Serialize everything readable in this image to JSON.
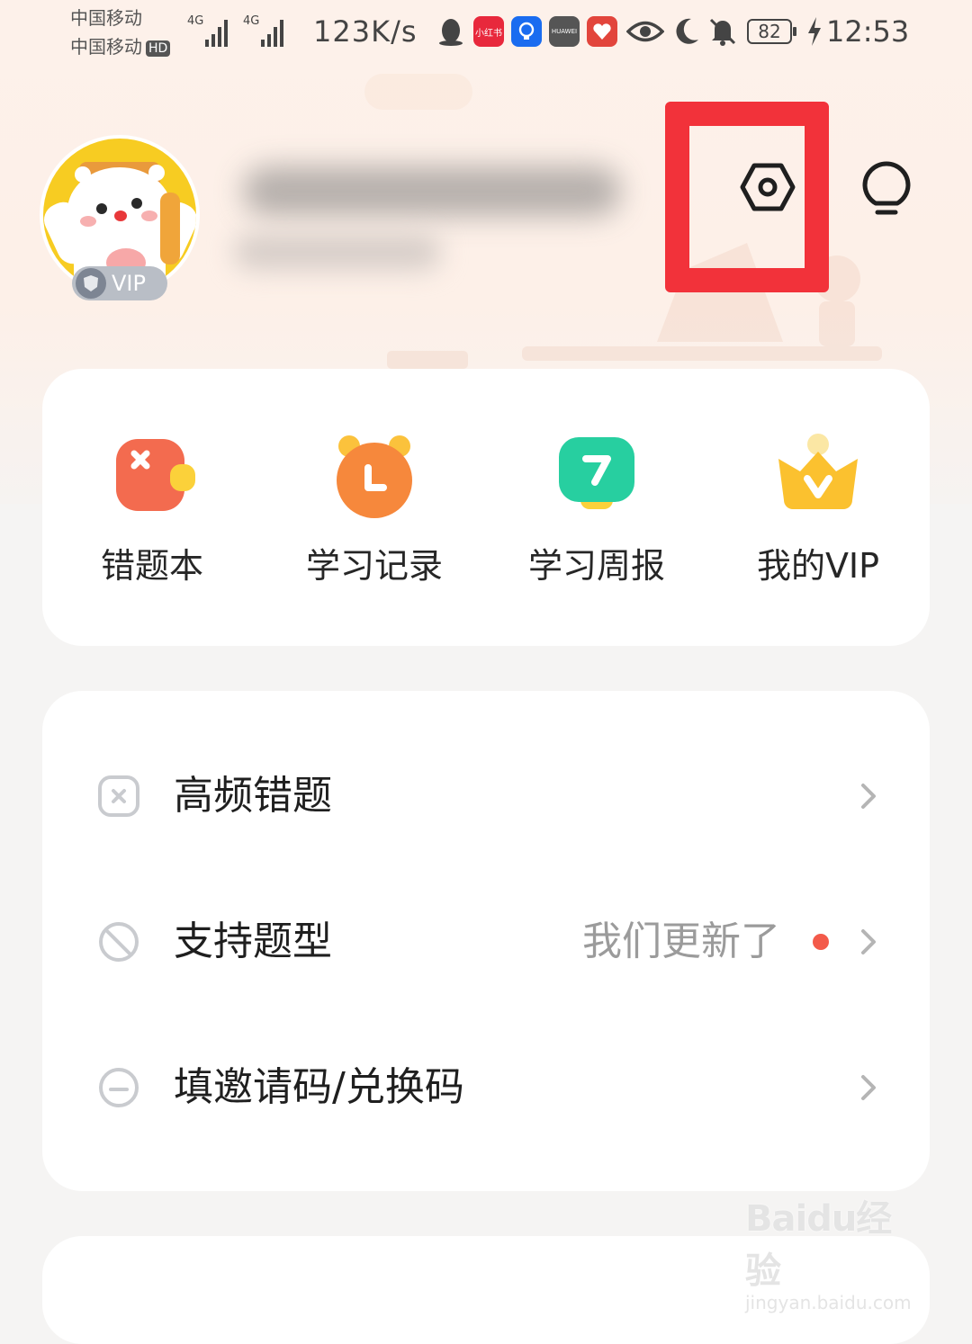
{
  "status_bar": {
    "carrier_1": "中国移动",
    "carrier_2": "中国移动",
    "hd_label": "HD",
    "network_tag_1": "4G",
    "network_tag_2": "4G",
    "speed": "123K/s",
    "app_icons": [
      "qq-icon",
      "xiaohongshu-icon",
      "lightbulb-app-icon",
      "huawei-store-icon",
      "pinduoduo-icon"
    ],
    "xiaohongshu_label": "小红书",
    "huawei_label": "HUAWEI",
    "battery": "82",
    "time": "12:53"
  },
  "profile": {
    "vip_badge": "VIP",
    "avatar_bg_color": "#f7cc22"
  },
  "header_actions": {
    "settings_icon": "settings-hexagon-icon",
    "message_icon": "message-bubble-icon",
    "highlight_color": "#f2323a"
  },
  "quick_actions": [
    {
      "label": "错题本",
      "icon": "wrong-questions-book-icon"
    },
    {
      "label": "学习记录",
      "icon": "study-record-clock-icon"
    },
    {
      "label": "学习周报",
      "icon": "weekly-report-calendar-icon"
    },
    {
      "label": "我的VIP",
      "icon": "vip-crown-icon"
    }
  ],
  "menu": [
    {
      "label": "高频错题",
      "icon": "close-square-icon",
      "note": ""
    },
    {
      "label": "支持题型",
      "icon": "shapes-icon",
      "note": "我们更新了",
      "has_dot": true
    },
    {
      "label": "填邀请码/兑换码",
      "icon": "coupon-icon",
      "note": ""
    }
  ],
  "watermark": {
    "line_1": "Baidu经验",
    "line_2": "jingyan.baidu.com"
  }
}
